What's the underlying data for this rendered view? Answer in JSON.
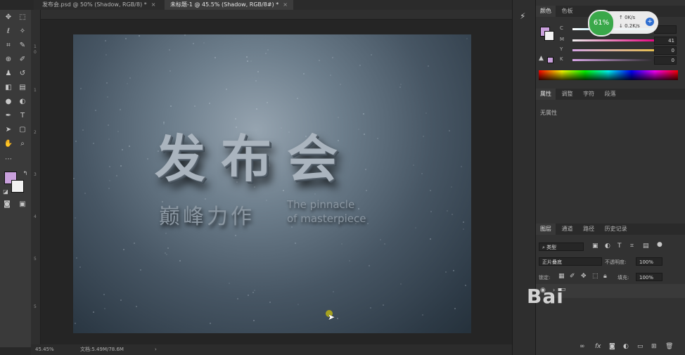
{
  "tabs": [
    {
      "label": "发布会.psd @ 50% (Shadow, RGB/8) *",
      "active": false
    },
    {
      "label": "未标题-1 @ 45.5% (Shadow, RGB/8#) *",
      "active": true
    }
  ],
  "tab_close": "×",
  "ruler_top": [
    "",
    "",
    "",
    "",
    "",
    ""
  ],
  "ruler_left": [
    "1",
    "5",
    "0",
    "1",
    "2",
    "3",
    "4",
    "5"
  ],
  "artwork": {
    "title": "发布会",
    "subtitle": "巅峰力作",
    "english_line1": "The pinnacle",
    "english_line2": "of masterpiece"
  },
  "status": {
    "zoom": "45.45%",
    "doc": "文档:5.49M/78.6M",
    "arrow": "›"
  },
  "color_panel": {
    "tabs": [
      "颜色",
      "色板"
    ],
    "channels": [
      {
        "label": "C",
        "value": ""
      },
      {
        "label": "M",
        "value": "41"
      },
      {
        "label": "Y",
        "value": "0"
      },
      {
        "label": "K",
        "value": "0"
      }
    ],
    "fg_color": "#c9a0dc",
    "bg_color": "#f2f2f2"
  },
  "properties_panel": {
    "tabs": [
      "属性",
      "调整",
      "字符",
      "段落"
    ],
    "empty_text": "无属性"
  },
  "layers_panel": {
    "tabs": [
      "图层",
      "通道",
      "路径",
      "历史记录"
    ],
    "filter_kind": "类型",
    "blend_mode": "正片叠底",
    "opacity_label": "不透明度:",
    "opacity_value": "100%",
    "lock_label": "锁定:",
    "fill_label": "填充:",
    "fill_value": "100%"
  },
  "net_widget": {
    "percent": "61%",
    "upload": "0K/s",
    "download": "0.2K/s",
    "add": "+"
  },
  "watermark": "Bai"
}
